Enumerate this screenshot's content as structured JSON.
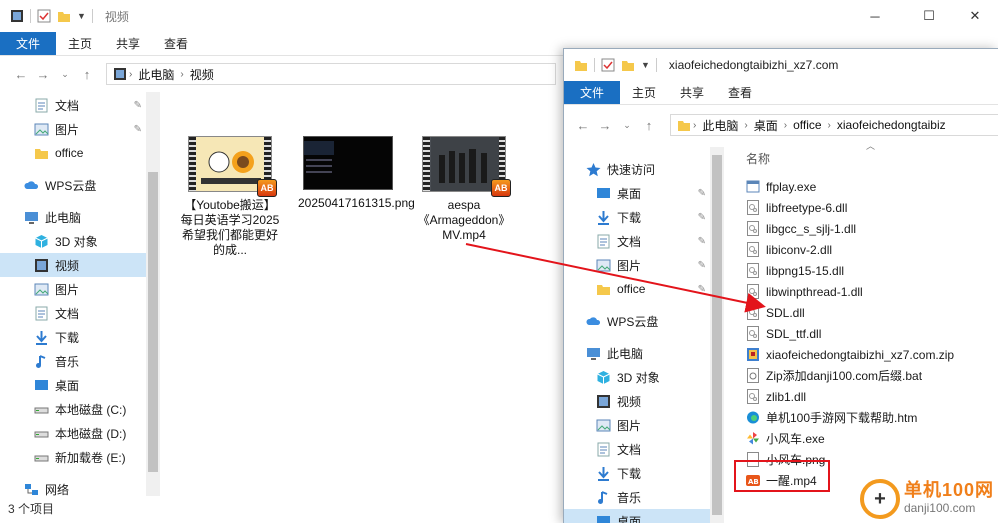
{
  "colors": {
    "accent": "#1a6fc2",
    "selection": "#cce4f7",
    "callout": "#e3141b",
    "watermark": "#f39a1e"
  },
  "w1": {
    "title": "视频",
    "tabs": [
      "文件",
      "主页",
      "共享",
      "查看"
    ],
    "crumbs": [
      "此电脑",
      "视频"
    ],
    "nav": [
      {
        "label": "文档",
        "icon": "document-icon",
        "pin": true
      },
      {
        "label": "图片",
        "icon": "pictures-icon",
        "pin": true
      },
      {
        "label": "office",
        "icon": "folder-icon",
        "pin": false
      },
      {
        "label": "WPS云盘",
        "icon": "cloud-icon",
        "pin": false
      },
      {
        "label": "此电脑",
        "icon": "computer-icon",
        "pin": false
      },
      {
        "label": "3D 对象",
        "icon": "3d-objects-icon",
        "pin": false
      },
      {
        "label": "视频",
        "icon": "video-icon",
        "pin": false,
        "selected": true
      },
      {
        "label": "图片",
        "icon": "pictures-icon",
        "pin": false
      },
      {
        "label": "文档",
        "icon": "document-icon",
        "pin": false
      },
      {
        "label": "下载",
        "icon": "download-icon",
        "pin": false
      },
      {
        "label": "音乐",
        "icon": "music-icon",
        "pin": false
      },
      {
        "label": "桌面",
        "icon": "desktop-icon",
        "pin": false
      },
      {
        "label": "本地磁盘 (C:)",
        "icon": "drive-icon",
        "pin": false
      },
      {
        "label": "本地磁盘 (D:)",
        "icon": "drive-icon",
        "pin": false
      },
      {
        "label": "新加载卷 (E:)",
        "icon": "drive-icon",
        "pin": false
      },
      {
        "label": "网络",
        "icon": "network-icon",
        "pin": false
      }
    ],
    "files": [
      {
        "name": "【Youtobe搬运】每日英语学习2025希望我们都能更好的成...",
        "kind": "video"
      },
      {
        "name": "20250417161315.png",
        "kind": "image"
      },
      {
        "name": "aespa《Armageddon》MV.mp4",
        "kind": "video"
      }
    ],
    "status": "3 个项目"
  },
  "w2": {
    "title": "xiaofeichedongtaibizhi_xz7.com",
    "tabs": [
      "文件",
      "主页",
      "共享",
      "查看"
    ],
    "crumbs": [
      "此电脑",
      "桌面",
      "office",
      "xiaofeichedongtaibiz"
    ],
    "column": "名称",
    "nav": [
      {
        "label": "快速访问",
        "icon": "star-icon",
        "pin": false
      },
      {
        "label": "桌面",
        "icon": "desktop-icon",
        "pin": true
      },
      {
        "label": "下载",
        "icon": "download-icon",
        "pin": true
      },
      {
        "label": "文档",
        "icon": "document-icon",
        "pin": true
      },
      {
        "label": "图片",
        "icon": "pictures-icon",
        "pin": true
      },
      {
        "label": "office",
        "icon": "folder-icon",
        "pin": true
      },
      {
        "label": "WPS云盘",
        "icon": "cloud-icon",
        "pin": false
      },
      {
        "label": "此电脑",
        "icon": "computer-icon",
        "pin": false
      },
      {
        "label": "3D 对象",
        "icon": "3d-objects-icon",
        "pin": false
      },
      {
        "label": "视频",
        "icon": "video-icon",
        "pin": false
      },
      {
        "label": "图片",
        "icon": "pictures-icon",
        "pin": false
      },
      {
        "label": "文档",
        "icon": "document-icon",
        "pin": false
      },
      {
        "label": "下载",
        "icon": "download-icon",
        "pin": false
      },
      {
        "label": "音乐",
        "icon": "music-icon",
        "pin": false
      },
      {
        "label": "桌面",
        "icon": "desktop-icon",
        "pin": false,
        "selected": true
      }
    ],
    "files": [
      {
        "name": "ffplay.exe",
        "icon": "exe-icon"
      },
      {
        "name": "libfreetype-6.dll",
        "icon": "dll-icon"
      },
      {
        "name": "libgcc_s_sjlj-1.dll",
        "icon": "dll-icon"
      },
      {
        "name": "libiconv-2.dll",
        "icon": "dll-icon"
      },
      {
        "name": "libpng15-15.dll",
        "icon": "dll-icon"
      },
      {
        "name": "libwinpthread-1.dll",
        "icon": "dll-icon"
      },
      {
        "name": "SDL.dll",
        "icon": "dll-icon"
      },
      {
        "name": "SDL_ttf.dll",
        "icon": "dll-icon"
      },
      {
        "name": "xiaofeichedongtaibizhi_xz7.com.zip",
        "icon": "zip-icon"
      },
      {
        "name": "Zip添加danji100.com后缀.bat",
        "icon": "bat-icon"
      },
      {
        "name": "zlib1.dll",
        "icon": "dll-icon"
      },
      {
        "name": "单机100手游网下载帮助.htm",
        "icon": "edge-icon"
      },
      {
        "name": "小风车.exe",
        "icon": "pinwheel-icon"
      },
      {
        "name": "小风车.png",
        "icon": "png-icon"
      },
      {
        "name": "一醒.mp4",
        "icon": "mp4-icon"
      }
    ]
  },
  "badge": "AB",
  "watermark": {
    "cn": "单机100网",
    "en": "danji100.com"
  }
}
